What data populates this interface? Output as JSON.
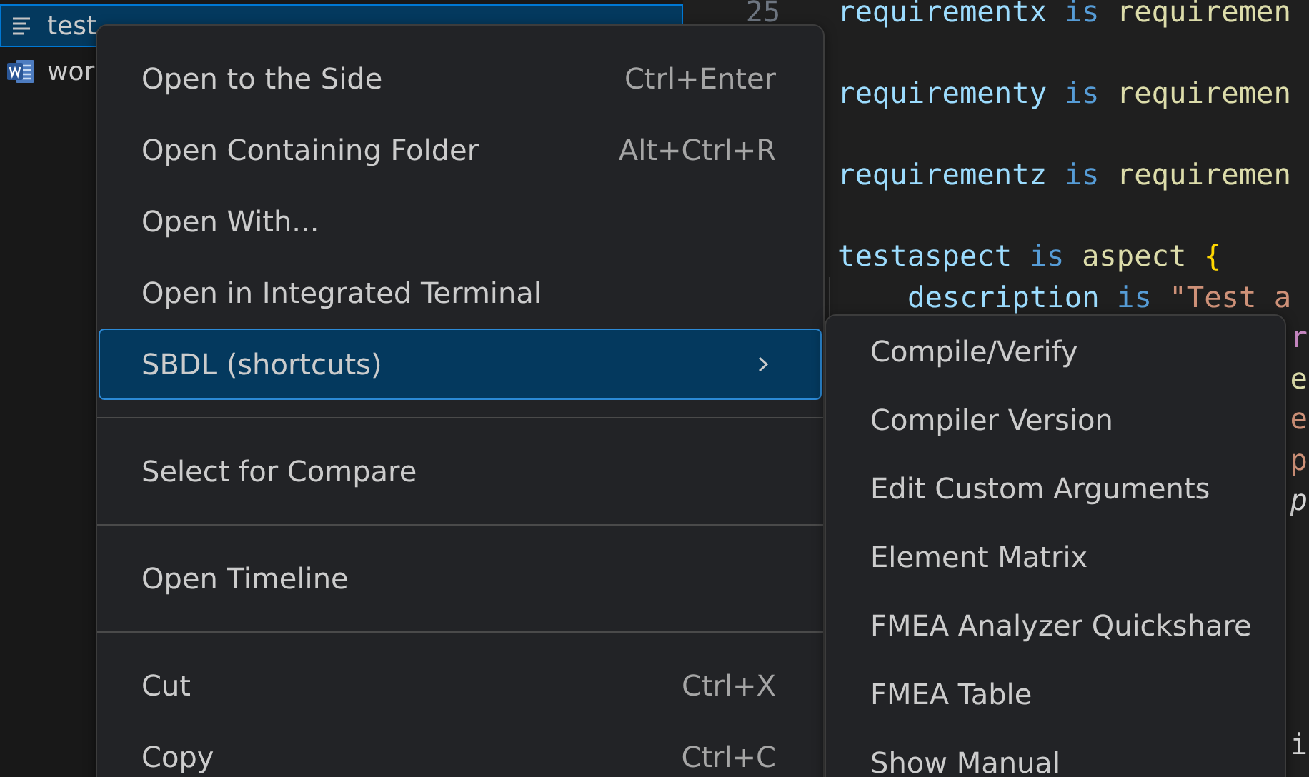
{
  "sidebar": {
    "items": [
      {
        "label": "test",
        "selected": true
      },
      {
        "label": "wor",
        "selected": false
      }
    ]
  },
  "editor": {
    "line_number": "25",
    "lines": [
      {
        "kind": "code",
        "tokens": [
          {
            "kind": "ident",
            "text": "requirementx"
          },
          {
            "kind": "keyword",
            "text": " is "
          },
          {
            "kind": "func",
            "text": "requiremen"
          }
        ]
      },
      {
        "kind": "blank"
      },
      {
        "kind": "code",
        "tokens": [
          {
            "kind": "ident",
            "text": "requirementy"
          },
          {
            "kind": "keyword",
            "text": " is "
          },
          {
            "kind": "func",
            "text": "requiremen"
          }
        ]
      },
      {
        "kind": "blank"
      },
      {
        "kind": "code",
        "tokens": [
          {
            "kind": "ident",
            "text": "requirementz"
          },
          {
            "kind": "keyword",
            "text": " is "
          },
          {
            "kind": "func",
            "text": "requiremen"
          }
        ]
      },
      {
        "kind": "blank"
      },
      {
        "kind": "code",
        "tokens": [
          {
            "kind": "ident",
            "text": "testaspect"
          },
          {
            "kind": "keyword",
            "text": " is "
          },
          {
            "kind": "func",
            "text": "aspect "
          },
          {
            "kind": "brace",
            "text": "{"
          }
        ]
      },
      {
        "kind": "indented",
        "tokens": [
          {
            "kind": "ident",
            "text": "description"
          },
          {
            "kind": "keyword",
            "text": " is "
          },
          {
            "kind": "string",
            "text": "\"Test a"
          }
        ]
      },
      {
        "kind": "tail",
        "tokens": [
          {
            "kind": "control",
            "text": "r"
          }
        ]
      },
      {
        "kind": "tail",
        "tokens": [
          {
            "kind": "func",
            "text": "e"
          }
        ]
      },
      {
        "kind": "tail",
        "tokens": [
          {
            "kind": "string",
            "text": "e"
          }
        ]
      },
      {
        "kind": "tail",
        "tokens": [
          {
            "kind": "string",
            "text": "p"
          }
        ]
      },
      {
        "kind": "tail",
        "tokens": [
          {
            "kind": "italic",
            "text": "p"
          }
        ]
      },
      {
        "kind": "blank"
      },
      {
        "kind": "blank"
      },
      {
        "kind": "blank"
      },
      {
        "kind": "blank"
      },
      {
        "kind": "blank"
      },
      {
        "kind": "tail",
        "tokens": [
          {
            "kind": "plain",
            "text": "i"
          }
        ]
      }
    ]
  },
  "context_menu": {
    "items": [
      {
        "kind": "item",
        "label": "Open to the Side",
        "shortcut": "Ctrl+Enter",
        "selected": false
      },
      {
        "kind": "item",
        "label": "Open Containing Folder",
        "shortcut": "Alt+Ctrl+R",
        "selected": false
      },
      {
        "kind": "item",
        "label": "Open With...",
        "selected": false
      },
      {
        "kind": "item",
        "label": "Open in Integrated Terminal",
        "selected": false
      },
      {
        "kind": "submenu",
        "label": "SBDL (shortcuts)",
        "selected": true
      },
      {
        "kind": "separator"
      },
      {
        "kind": "item",
        "label": "Select for Compare",
        "selected": false
      },
      {
        "kind": "separator"
      },
      {
        "kind": "item",
        "label": "Open Timeline",
        "selected": false
      },
      {
        "kind": "separator"
      },
      {
        "kind": "item",
        "label": "Cut",
        "shortcut": "Ctrl+X",
        "selected": false
      },
      {
        "kind": "item",
        "label": "Copy",
        "shortcut": "Ctrl+C",
        "selected": false
      }
    ]
  },
  "submenu": {
    "items": [
      {
        "label": "Compile/Verify",
        "selected": false
      },
      {
        "label": "Compiler Version",
        "selected": false
      },
      {
        "label": "Edit Custom Arguments",
        "selected": false
      },
      {
        "label": "Element Matrix",
        "selected": false
      },
      {
        "label": "FMEA Analyzer Quickshare",
        "selected": false
      },
      {
        "label": "FMEA Table",
        "selected": false
      },
      {
        "label": "Show Manual",
        "selected": false
      }
    ]
  }
}
